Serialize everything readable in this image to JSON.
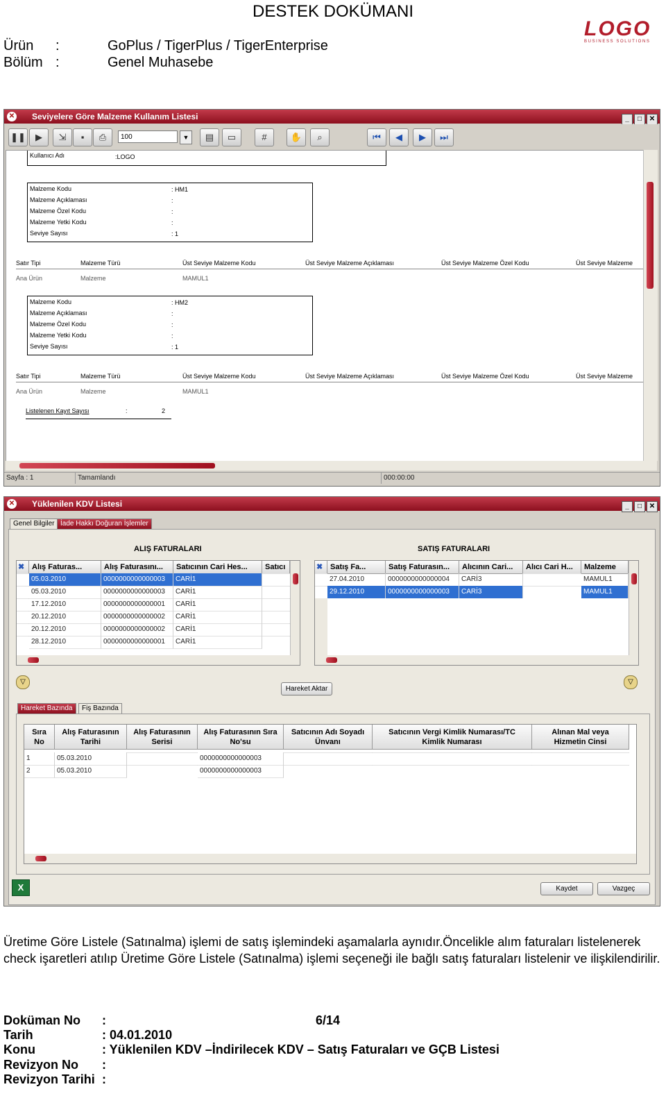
{
  "header": {
    "title": "DESTEK DOKÜMANI",
    "product_label": "Ürün",
    "product_value": "GoPlus / TigerPlus / TigerEnterprise",
    "section_label": "Bölüm",
    "section_value": "Genel Muhasebe",
    "colon": ":",
    "logo_text": "LOGO",
    "logo_subtext": "BUSINESS SOLUTIONS"
  },
  "window1": {
    "title": "Seviyelere Göre Malzeme Kullanım Listesi",
    "zoom_value": "100",
    "user_label": "Kullanıcı Adı",
    "user_value": ":LOGO",
    "item_labels": [
      "Malzeme Kodu",
      "Malzeme Açıklaması",
      "Malzeme Özel Kodu",
      "Malzeme Yetki Kodu",
      "Seviye Sayısı"
    ],
    "block1_values": [
      ": HM1",
      ":",
      ":",
      ":",
      ": 1"
    ],
    "block2_values": [
      ": HM2",
      ":",
      ":",
      ":",
      ": 1"
    ],
    "columns": [
      "Satır Tipi",
      "Malzeme Türü",
      "Üst Seviye Malzeme Kodu",
      "Üst Seviye Malzeme Açıklaması",
      "Üst Seviye Malzeme Özel Kodu",
      "Üst Seviye Malzeme"
    ],
    "row": [
      "Ana Ürün",
      "Malzeme",
      "MAMUL1"
    ],
    "count_label": "Listelenen Kayıt Sayısı",
    "count_colon": ":",
    "count_value": "2",
    "status_page": "Sayfa : 1",
    "status_state": "Tamamlandı",
    "status_time": "000:00:00"
  },
  "window2": {
    "title": "Yüklenilen KDV Listesi",
    "tabs": [
      "Genel Bilgiler",
      "İade Hakkı Doğuran İşlemler"
    ],
    "purchase_title": "ALIŞ FATURALARI",
    "sales_title": "SATIŞ FATURALARI",
    "purchase_headers": [
      "Alış Faturas...",
      "Alış Faturasını...",
      "Satıcının Cari Hes...",
      "Satıcı"
    ],
    "purchase_rows": [
      [
        "05.03.2010",
        "0000000000000003",
        "CARİ1"
      ],
      [
        "05.03.2010",
        "0000000000000003",
        "CARİ1"
      ],
      [
        "17.12.2010",
        "0000000000000001",
        "CARİ1"
      ],
      [
        "20.12.2010",
        "0000000000000002",
        "CARİ1"
      ],
      [
        "20.12.2010",
        "0000000000000002",
        "CARİ1"
      ],
      [
        "28.12.2010",
        "0000000000000001",
        "CARİ1"
      ]
    ],
    "sales_headers": [
      "Satış Fa...",
      "Satış Faturasın...",
      "Alıcının Cari...",
      "Alıcı Cari H...",
      "Malzeme"
    ],
    "sales_rows": [
      [
        "27.04.2010",
        "0000000000000004",
        "CARİ3",
        "",
        "MAMUL1"
      ],
      [
        "29.12.2010",
        "0000000000000003",
        "CARİ3",
        "",
        "MAMUL1"
      ]
    ],
    "transfer_button": "Hareket Aktar",
    "bottom_tabs": [
      "Hareket Bazında",
      "Fiş Bazında"
    ],
    "detail_headers": [
      "Sıra\nNo",
      "Alış Faturasının\nTarihi",
      "Alış Faturasının\nSerisi",
      "Alış Faturasının Sıra\nNo'su",
      "Satıcının Adı Soyadı\nÜnvanı",
      "Satıcının Vergi Kimlik Numarası/TC\nKimlik Numarası",
      "Alınan Mal veya\nHizmetin Cinsi"
    ],
    "detail_rows": [
      [
        "1",
        "05.03.2010",
        "",
        "0000000000000003"
      ],
      [
        "2",
        "05.03.2010",
        "",
        "0000000000000003"
      ]
    ],
    "save_button": "Kaydet",
    "cancel_button": "Vazgeç"
  },
  "paragraph": "Üretime Göre Listele (Satınalma) işlemi de satış işlemindeki aşamalarla aynıdır.Öncelikle alım faturaları listelenerek check işaretleri atılıp Üretime Göre Listele (Satınalma) işlemi seçeneği ile bağlı satış faturaları listelenir ve ilişkilendirilir.",
  "footer": {
    "doc_no_label": "Doküman No",
    "doc_no_value": ":",
    "page": "6/14",
    "date_label": "Tarih",
    "date_value": ": 04.01.2010",
    "subject_label": "Konu",
    "subject_value": ": Yüklenilen KDV –İndirilecek KDV – Satış Faturaları ve GÇB Listesi",
    "rev_no_label": "Revizyon No",
    "rev_no_value": ":",
    "rev_date_label": "Revizyon Tarihi",
    "rev_date_value": ":"
  }
}
